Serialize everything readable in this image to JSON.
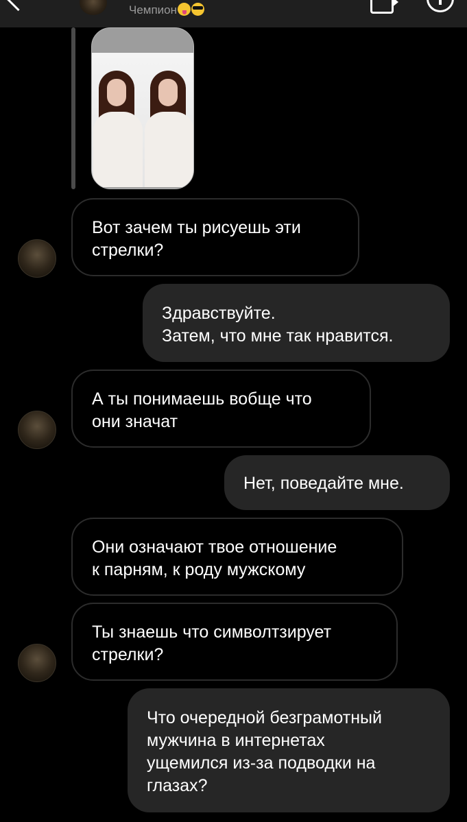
{
  "header": {
    "title": "Чемпион",
    "title_emojis": [
      "squinting-face-with-tongue",
      "smiling-face-with-sunglasses"
    ],
    "icons": [
      "back-chevron-icon",
      "video-call-icon",
      "info-icon"
    ]
  },
  "shared_post": {
    "kind": "photo",
    "description_icon": "photo-thumbnail"
  },
  "messages": [
    {
      "from": "them",
      "text": "Вот зачем ты рисуешь эти\nстрелки?"
    },
    {
      "from": "me",
      "text": "Здравствуйте.\nЗатем, что мне так нравится."
    },
    {
      "from": "them",
      "text": "А ты понимаешь вобще что\nони значат"
    },
    {
      "from": "me",
      "text": "Нет, поведайте мне."
    },
    {
      "from": "them",
      "text": "Они означают твое отношение\nк парням, к роду мужскому"
    },
    {
      "from": "them",
      "text": "Ты знаешь что символтзирует\nстрелки?"
    },
    {
      "from": "me",
      "text": "Что очередной безграмотный\nмужчина в интернетах\nущемился из-за подводки на\nглазах?"
    }
  ],
  "colors": {
    "background": "#000000",
    "header": "#1f1f1f",
    "outgoing_bubble": "#262626",
    "incoming_border": "#2c2c2c",
    "title_text": "#9a9a9a",
    "text": "#ffffff"
  }
}
